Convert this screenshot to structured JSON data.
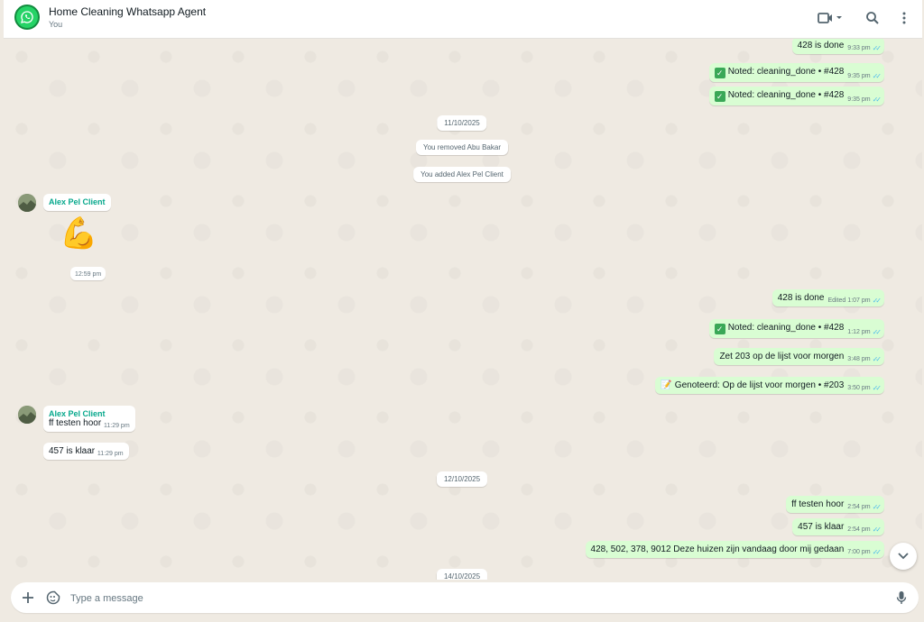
{
  "header": {
    "title": "Home Cleaning Whatsapp Agent",
    "subtitle": "You",
    "icons": [
      "whatsapp-logo-icon",
      "video-call-icon",
      "search-icon",
      "menu-icon"
    ]
  },
  "colors": {
    "outgoing_bubble": "#d9fdd3",
    "incoming_bubble": "#ffffff",
    "read_ticks": "#53bdeb",
    "sender_name": "#06a88c",
    "chat_bg": "#efeae2"
  },
  "messages": {
    "m1": {
      "text": "428 is done",
      "time": "9:33 pm"
    },
    "m2": {
      "text": "Noted: cleaning_done • #428",
      "time": "9:35 pm"
    },
    "m3": {
      "text": "Noted: cleaning_done • #428",
      "time": "9:35 pm"
    },
    "date1": "11/10/2025",
    "sys1": "You removed Abu Bakar",
    "sys2": "You added Alex Pel Client",
    "in1": {
      "sender": "Alex Pel Client",
      "sticker": "💪",
      "time": "12:59 pm"
    },
    "m4": {
      "text": "428 is done",
      "edited": "Edited",
      "time": "1:07 pm"
    },
    "m5": {
      "text": "Noted: cleaning_done • #428",
      "time": "1:12 pm"
    },
    "m6": {
      "text": "Zet 203 op de lijst voor morgen",
      "time": "3:48 pm"
    },
    "m7": {
      "text": "Genoteerd: Op de lijst voor morgen • #203",
      "time": "3:50 pm"
    },
    "in2": {
      "sender": "Alex Pel Client",
      "text": "ff testen hoor",
      "time": "11:29 pm"
    },
    "in3": {
      "text": "457 is klaar",
      "time": "11:29 pm"
    },
    "date2": "12/10/2025",
    "m8": {
      "text": "ff testen hoor",
      "time": "2:54 pm"
    },
    "m9": {
      "text": "457 is klaar",
      "time": "2:54 pm"
    },
    "m10": {
      "text": "428, 502, 378, 9012 Deze huizen zijn vandaag door mij gedaan",
      "time": "7:00 pm"
    },
    "date3": "14/10/2025"
  },
  "composer": {
    "placeholder": "Type a message"
  }
}
